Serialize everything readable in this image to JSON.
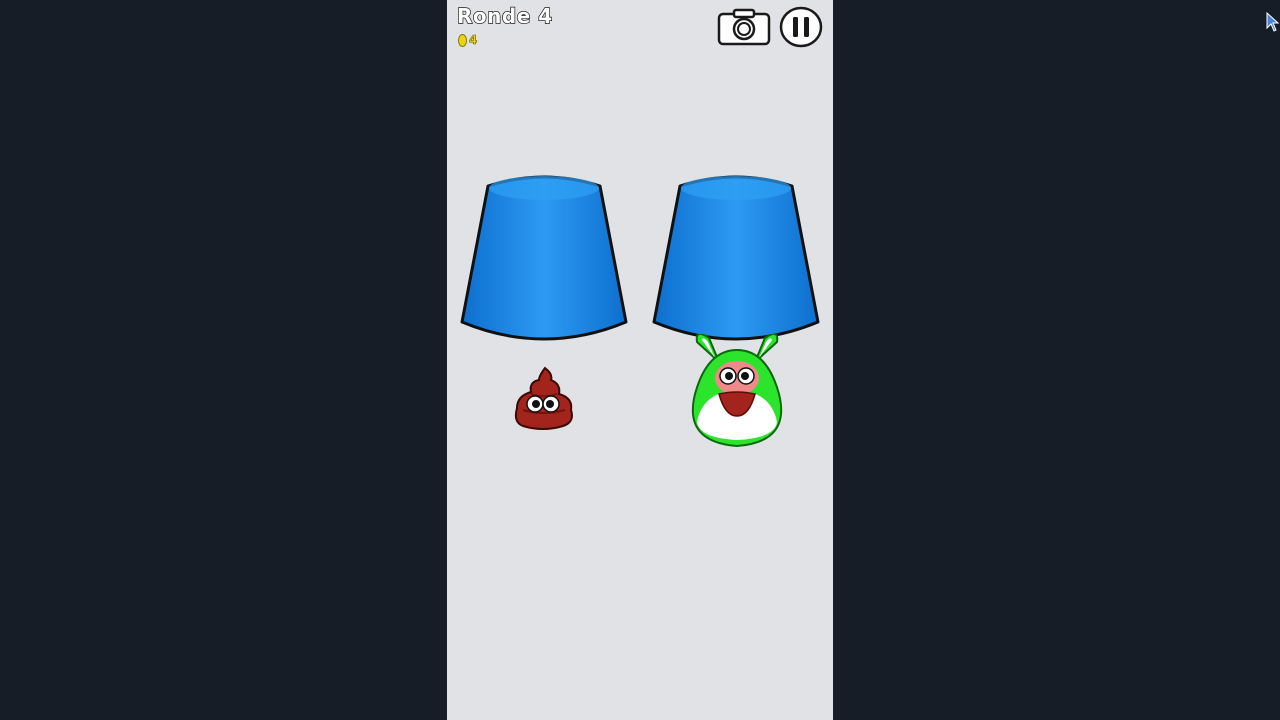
{
  "hud": {
    "round_label": "Ronde 4",
    "coins": "4"
  },
  "toolbar": {
    "camera_icon": "camera-icon",
    "pause_icon": "pause-icon"
  },
  "scene": {
    "cups": [
      {
        "id": "left",
        "color": "#1f8ee8",
        "revealed": "poop"
      },
      {
        "id": "right",
        "color": "#1f8ee8",
        "revealed": "green-pou-bunny"
      }
    ]
  },
  "colors": {
    "background": "#161d27",
    "playfield": "#e1e2e6",
    "cup_blue": "#1f8ee8",
    "coin_yellow": "#e8d51a",
    "bunny_green": "#2de42d",
    "poop_brown": "#a3241c"
  }
}
